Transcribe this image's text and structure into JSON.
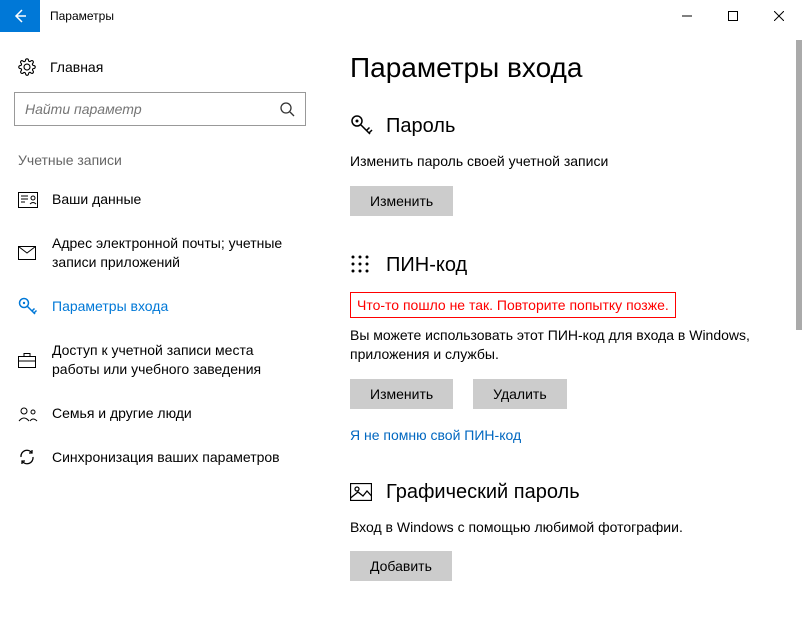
{
  "window": {
    "title": "Параметры",
    "minimize": "—",
    "maximize": "☐",
    "close": "✕"
  },
  "sidebar": {
    "home": "Главная",
    "search_placeholder": "Найти параметр",
    "category": "Учетные записи",
    "items": [
      {
        "label": "Ваши данные"
      },
      {
        "label": "Адрес электронной почты; учетные записи приложений"
      },
      {
        "label": "Параметры входа"
      },
      {
        "label": "Доступ к учетной записи места работы или учебного заведения"
      },
      {
        "label": "Семья и другие люди"
      },
      {
        "label": "Синхронизация ваших параметров"
      }
    ]
  },
  "main": {
    "heading": "Параметры входа",
    "password": {
      "title": "Пароль",
      "desc": "Изменить пароль своей учетной записи",
      "change_btn": "Изменить"
    },
    "pin": {
      "title": "ПИН-код",
      "error": "Что-то пошло не так. Повторите попытку позже.",
      "desc": "Вы можете использовать этот ПИН-код для входа в Windows, приложения и службы.",
      "change_btn": "Изменить",
      "delete_btn": "Удалить",
      "forgot_link": "Я не помню свой ПИН-код"
    },
    "picture": {
      "title": "Графический пароль",
      "desc": "Вход в Windows с помощью любимой фотографии.",
      "add_btn": "Добавить"
    }
  }
}
